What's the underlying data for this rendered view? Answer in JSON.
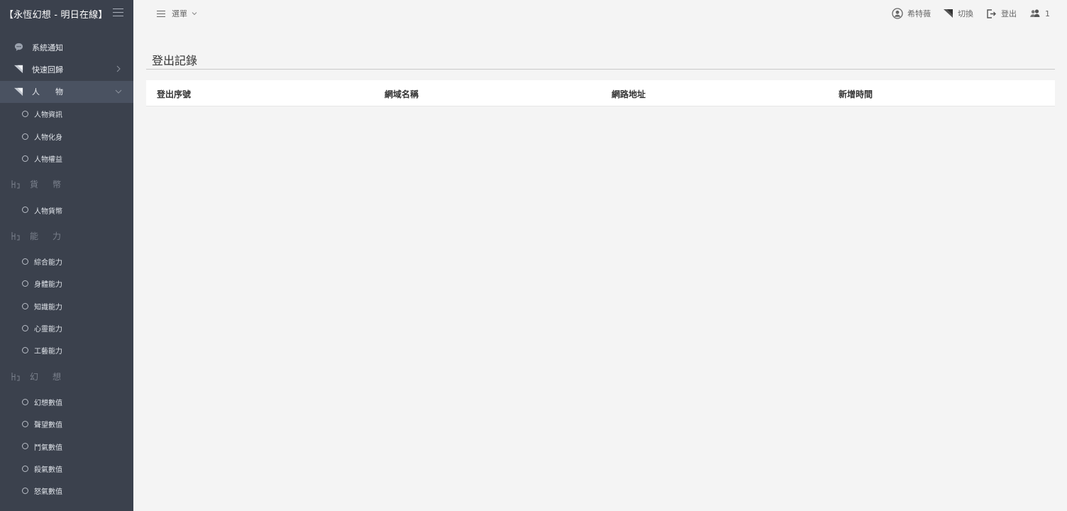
{
  "brand": {
    "title": "【永恆幻想 - 明日在線】"
  },
  "topbar": {
    "menu_label": "選單",
    "user_name": "希特薇",
    "switch_label": "切換",
    "logout_label": "登出",
    "online_count": "1"
  },
  "sidebar": {
    "items": [
      {
        "label": "系統通知",
        "icon": "chat-bubble-icon"
      },
      {
        "label": "快速回歸",
        "icon": "send-arrow-icon"
      },
      {
        "label": "人　　物",
        "icon": "send-arrow-icon",
        "active": true
      }
    ],
    "person_sub": [
      "人物資訊",
      "人物化身",
      "人物權益"
    ],
    "currency_section": "貨幣",
    "currency_sub": [
      "人物貨幣"
    ],
    "ability_section": "能力",
    "ability_sub": [
      "綜合能力",
      "身體能力",
      "知識能力",
      "心靈能力",
      "工藝能力"
    ],
    "fantasy_section": "幻想",
    "fantasy_sub": [
      "幻想數值",
      "聲望數值",
      "鬥氣數值",
      "殺氣數值",
      "怒氣數值"
    ]
  },
  "main": {
    "title": "登出記錄",
    "columns": [
      "登出序號",
      "網域名稱",
      "網路地址",
      "新增時間"
    ]
  },
  "colors": {
    "sidebar_bg": "#3b414d",
    "sidebar_active": "#4a5261",
    "page_bg": "#f4f4f4"
  }
}
